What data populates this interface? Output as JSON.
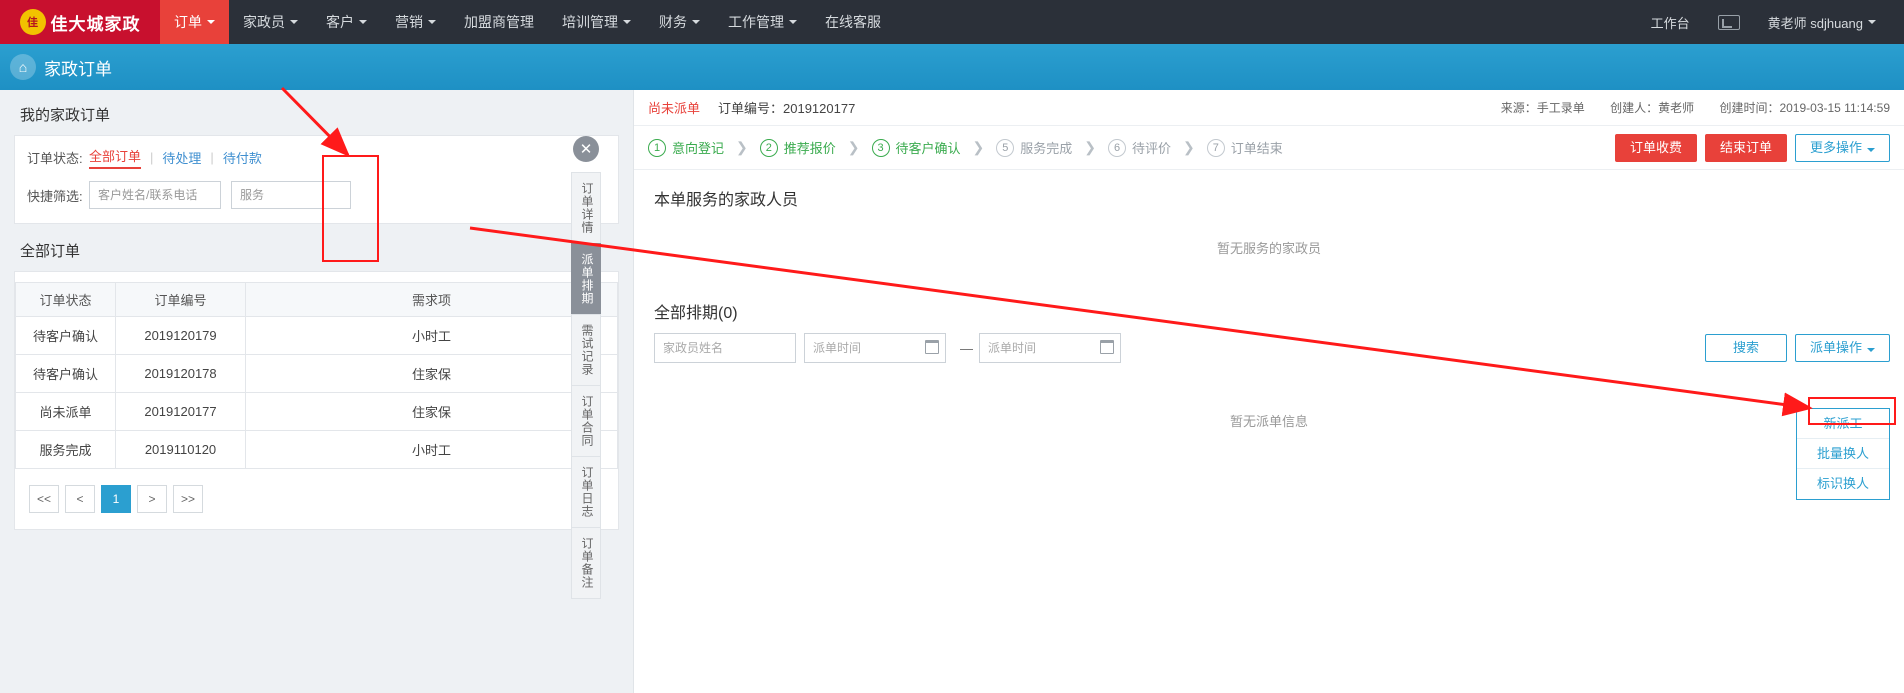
{
  "topnav": {
    "logo_text": "佳大城家政",
    "logo_badge": "佳",
    "items": [
      {
        "label": "订单",
        "caret": true,
        "active": true
      },
      {
        "label": "家政员",
        "caret": true,
        "active": false
      },
      {
        "label": "客户",
        "caret": true,
        "active": false
      },
      {
        "label": "营销",
        "caret": true,
        "active": false
      },
      {
        "label": "加盟商管理",
        "caret": false,
        "active": false
      },
      {
        "label": "培训管理",
        "caret": true,
        "active": false
      },
      {
        "label": "财务",
        "caret": true,
        "active": false
      },
      {
        "label": "工作管理",
        "caret": true,
        "active": false
      },
      {
        "label": "在线客服",
        "caret": false,
        "active": false
      }
    ],
    "right": {
      "workbench": "工作台",
      "flag_icon": "flag-icon",
      "user": "黄老师 sdjhuang"
    }
  },
  "page_header": {
    "icon": "house-icon",
    "title": "家政订单"
  },
  "left": {
    "my_orders_title": "我的家政订单",
    "status_filter": {
      "label": "订单状态:",
      "options": [
        "全部订单",
        "待处理",
        "待付款"
      ],
      "active": "全部订单"
    },
    "quick_filter": {
      "label": "快捷筛选:",
      "name_placeholder": "客户姓名/联系电话",
      "service_placeholder": "服务"
    },
    "all_orders_title": "全部订单",
    "table": {
      "headers": [
        "订单状态",
        "订单编号",
        "需求项"
      ],
      "rows": [
        {
          "status": "待客户确认",
          "status_color": "blue",
          "no": "2019120179",
          "item": "小时工"
        },
        {
          "status": "待客户确认",
          "status_color": "blue",
          "no": "2019120178",
          "item": "住家保"
        },
        {
          "status": "尚未派单",
          "status_color": "red",
          "no": "2019120177",
          "item": "住家保"
        },
        {
          "status": "服务完成",
          "status_color": "blue",
          "no": "2019110120",
          "item": "小时工"
        }
      ]
    },
    "pager": {
      "first": "<<",
      "prev": "<",
      "pages": [
        "1"
      ],
      "current": "1",
      "next": ">",
      "last": ">>"
    }
  },
  "rail": {
    "close_icon": "close-icon",
    "tabs": [
      {
        "label": "订单详情",
        "active": false
      },
      {
        "label": "派单排期",
        "active": true
      },
      {
        "label": "需试记录",
        "active": false
      },
      {
        "label": "订单合同",
        "active": false
      },
      {
        "label": "订单日志",
        "active": false
      },
      {
        "label": "订单备注",
        "active": false
      }
    ]
  },
  "detail": {
    "status": "尚未派单",
    "order_no_label": "订单编号：2019120177",
    "meta": {
      "source": "来源：手工录单",
      "creator": "创建人：黄老师",
      "created": "创建时间：2019-03-15 11:14:59"
    },
    "steps": [
      {
        "num": "①",
        "label": "意向登记",
        "done": true
      },
      {
        "num": "②",
        "label": "推荐报价",
        "done": true
      },
      {
        "num": "③",
        "label": "待客户确认",
        "done": true
      },
      {
        "num": "⑤",
        "label": "服务完成",
        "done": false
      },
      {
        "num": "⑥",
        "label": "待评价",
        "done": false
      },
      {
        "num": "⑦",
        "label": "订单结束",
        "done": false
      }
    ],
    "buttons": {
      "charge": "订单收费",
      "finish": "结束订单",
      "more": "更多操作"
    },
    "staff_section": {
      "title": "本单服务的家政人员",
      "empty": "暂无服务的家政员"
    },
    "schedule_section": {
      "title": "全部排期(0)",
      "name_placeholder": "家政员姓名",
      "date_start_placeholder": "派单时间",
      "date_end_placeholder": "派单时间",
      "date_separator": "—",
      "search_button": "搜索",
      "action_button": "派单操作",
      "empty": "暂无派单信息",
      "dropdown": [
        {
          "label": "新派工",
          "highlight": true
        },
        {
          "label": "批量换人",
          "highlight": false
        },
        {
          "label": "标识换人",
          "highlight": false
        }
      ]
    }
  },
  "annotations": {
    "accent": "#ff1a1a"
  }
}
